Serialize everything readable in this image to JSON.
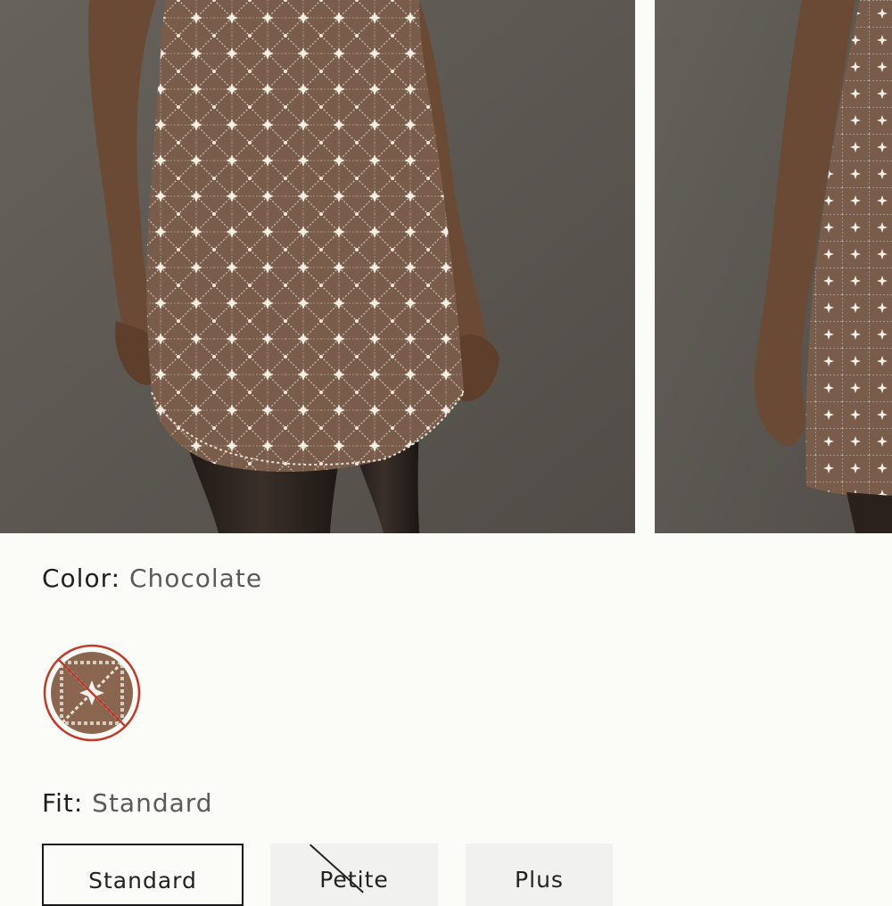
{
  "product": {
    "color_label": "Color:",
    "color_value": "Chocolate",
    "fit_label": "Fit:",
    "fit_value": "Standard"
  },
  "gallery": {
    "images": [
      {
        "name": "product-photo-front"
      },
      {
        "name": "product-photo-side"
      }
    ]
  },
  "swatches": [
    {
      "name": "Chocolate",
      "available": false,
      "selected": true,
      "color": "#8a6650"
    }
  ],
  "fit_options": [
    {
      "label": "Standard",
      "selected": true,
      "available": true
    },
    {
      "label": "Petite",
      "selected": false,
      "available": false
    },
    {
      "label": "Plus",
      "selected": false,
      "available": true
    }
  ],
  "colors": {
    "photo_background": "#5d5853",
    "dress": "#7a5c4a",
    "beading": "#e9e3da",
    "skin": "#6b4a35",
    "unavailable_mark": "#c0392b"
  }
}
